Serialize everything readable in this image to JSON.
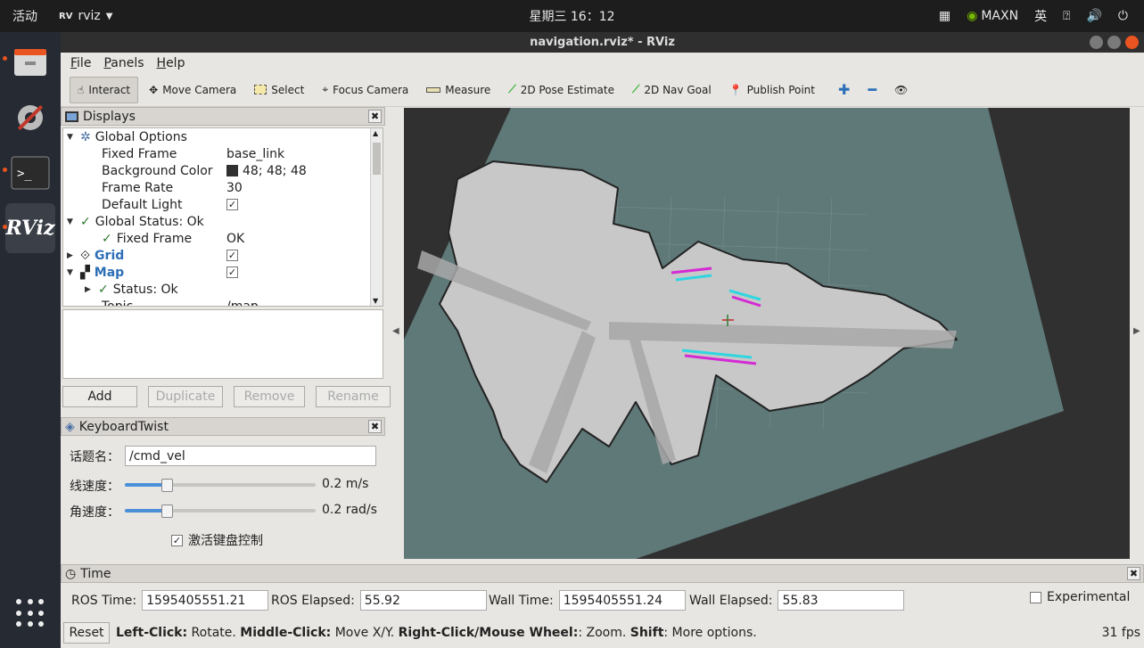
{
  "topbar": {
    "activities": "活动",
    "app_name": "rviz",
    "clock": "星期三 16：12",
    "gpu_mode": "MAXN",
    "input_method": "英"
  },
  "window": {
    "title": "navigation.rviz* - RViz"
  },
  "menu": [
    "File",
    "Panels",
    "Help"
  ],
  "toolbar": {
    "tools": [
      {
        "label": "Interact",
        "icon": "hand-icon",
        "active": true
      },
      {
        "label": "Move Camera",
        "icon": "move-camera-icon"
      },
      {
        "label": "Select",
        "icon": "select-box-icon"
      },
      {
        "label": "Focus Camera",
        "icon": "focus-camera-icon"
      },
      {
        "label": "Measure",
        "icon": "ruler-icon"
      },
      {
        "label": "2D Pose Estimate",
        "icon": "green-arrow-icon"
      },
      {
        "label": "2D Nav Goal",
        "icon": "green-arrow-icon"
      },
      {
        "label": "Publish Point",
        "icon": "map-pin-icon"
      }
    ]
  },
  "displays": {
    "title": "Displays",
    "global_options": "Global Options",
    "fixed_frame_label": "Fixed Frame",
    "fixed_frame_value": "base_link",
    "bg_color_label": "Background Color",
    "bg_color_value": "48; 48; 48",
    "frame_rate_label": "Frame Rate",
    "frame_rate_value": "30",
    "default_light_label": "Default Light",
    "global_status": "Global Status: Ok",
    "fixed_frame_status_label": "Fixed Frame",
    "fixed_frame_status_value": "OK",
    "grid": "Grid",
    "map": "Map",
    "map_status": "Status: Ok",
    "topic_label": "Topic",
    "topic_value": "/map"
  },
  "display_buttons": {
    "add": "Add",
    "duplicate": "Duplicate",
    "remove": "Remove",
    "rename": "Rename"
  },
  "keyboard_twist": {
    "title": "KeyboardTwist",
    "topic_label": "话题名：",
    "topic_value": "/cmd_vel",
    "linear_label": "线速度：",
    "linear_value": "0.2 m/s",
    "linear_level": 0.22,
    "angular_label": "角速度：",
    "angular_value": "0.2 rad/s",
    "angular_level": 0.22,
    "activate_label": "激活键盘控制"
  },
  "time": {
    "title": "Time",
    "ros_time_label": "ROS Time:",
    "ros_time_value": "1595405551.21",
    "ros_elapsed_label": "ROS Elapsed:",
    "ros_elapsed_value": "55.92",
    "wall_time_label": "Wall Time:",
    "wall_time_value": "1595405551.24",
    "wall_elapsed_label": "Wall Elapsed:",
    "wall_elapsed_value": "55.83",
    "experimental_label": "Experimental"
  },
  "status_bar": {
    "reset": "Reset",
    "left_click_key": "Left-Click:",
    "left_click_desc": " Rotate. ",
    "middle_click_key": "Middle-Click:",
    "middle_click_desc": " Move X/Y. ",
    "right_click_key": "Right-Click/Mouse Wheel:",
    "right_click_desc": ": Zoom. ",
    "shift_key": "Shift",
    "shift_desc": ": More options.",
    "fps": "31 fps"
  },
  "colors": {
    "accent": "#e95420",
    "viewport_bg": "#303030",
    "map_unknown": "#5f7878",
    "map_free": "#c8c8c8"
  }
}
